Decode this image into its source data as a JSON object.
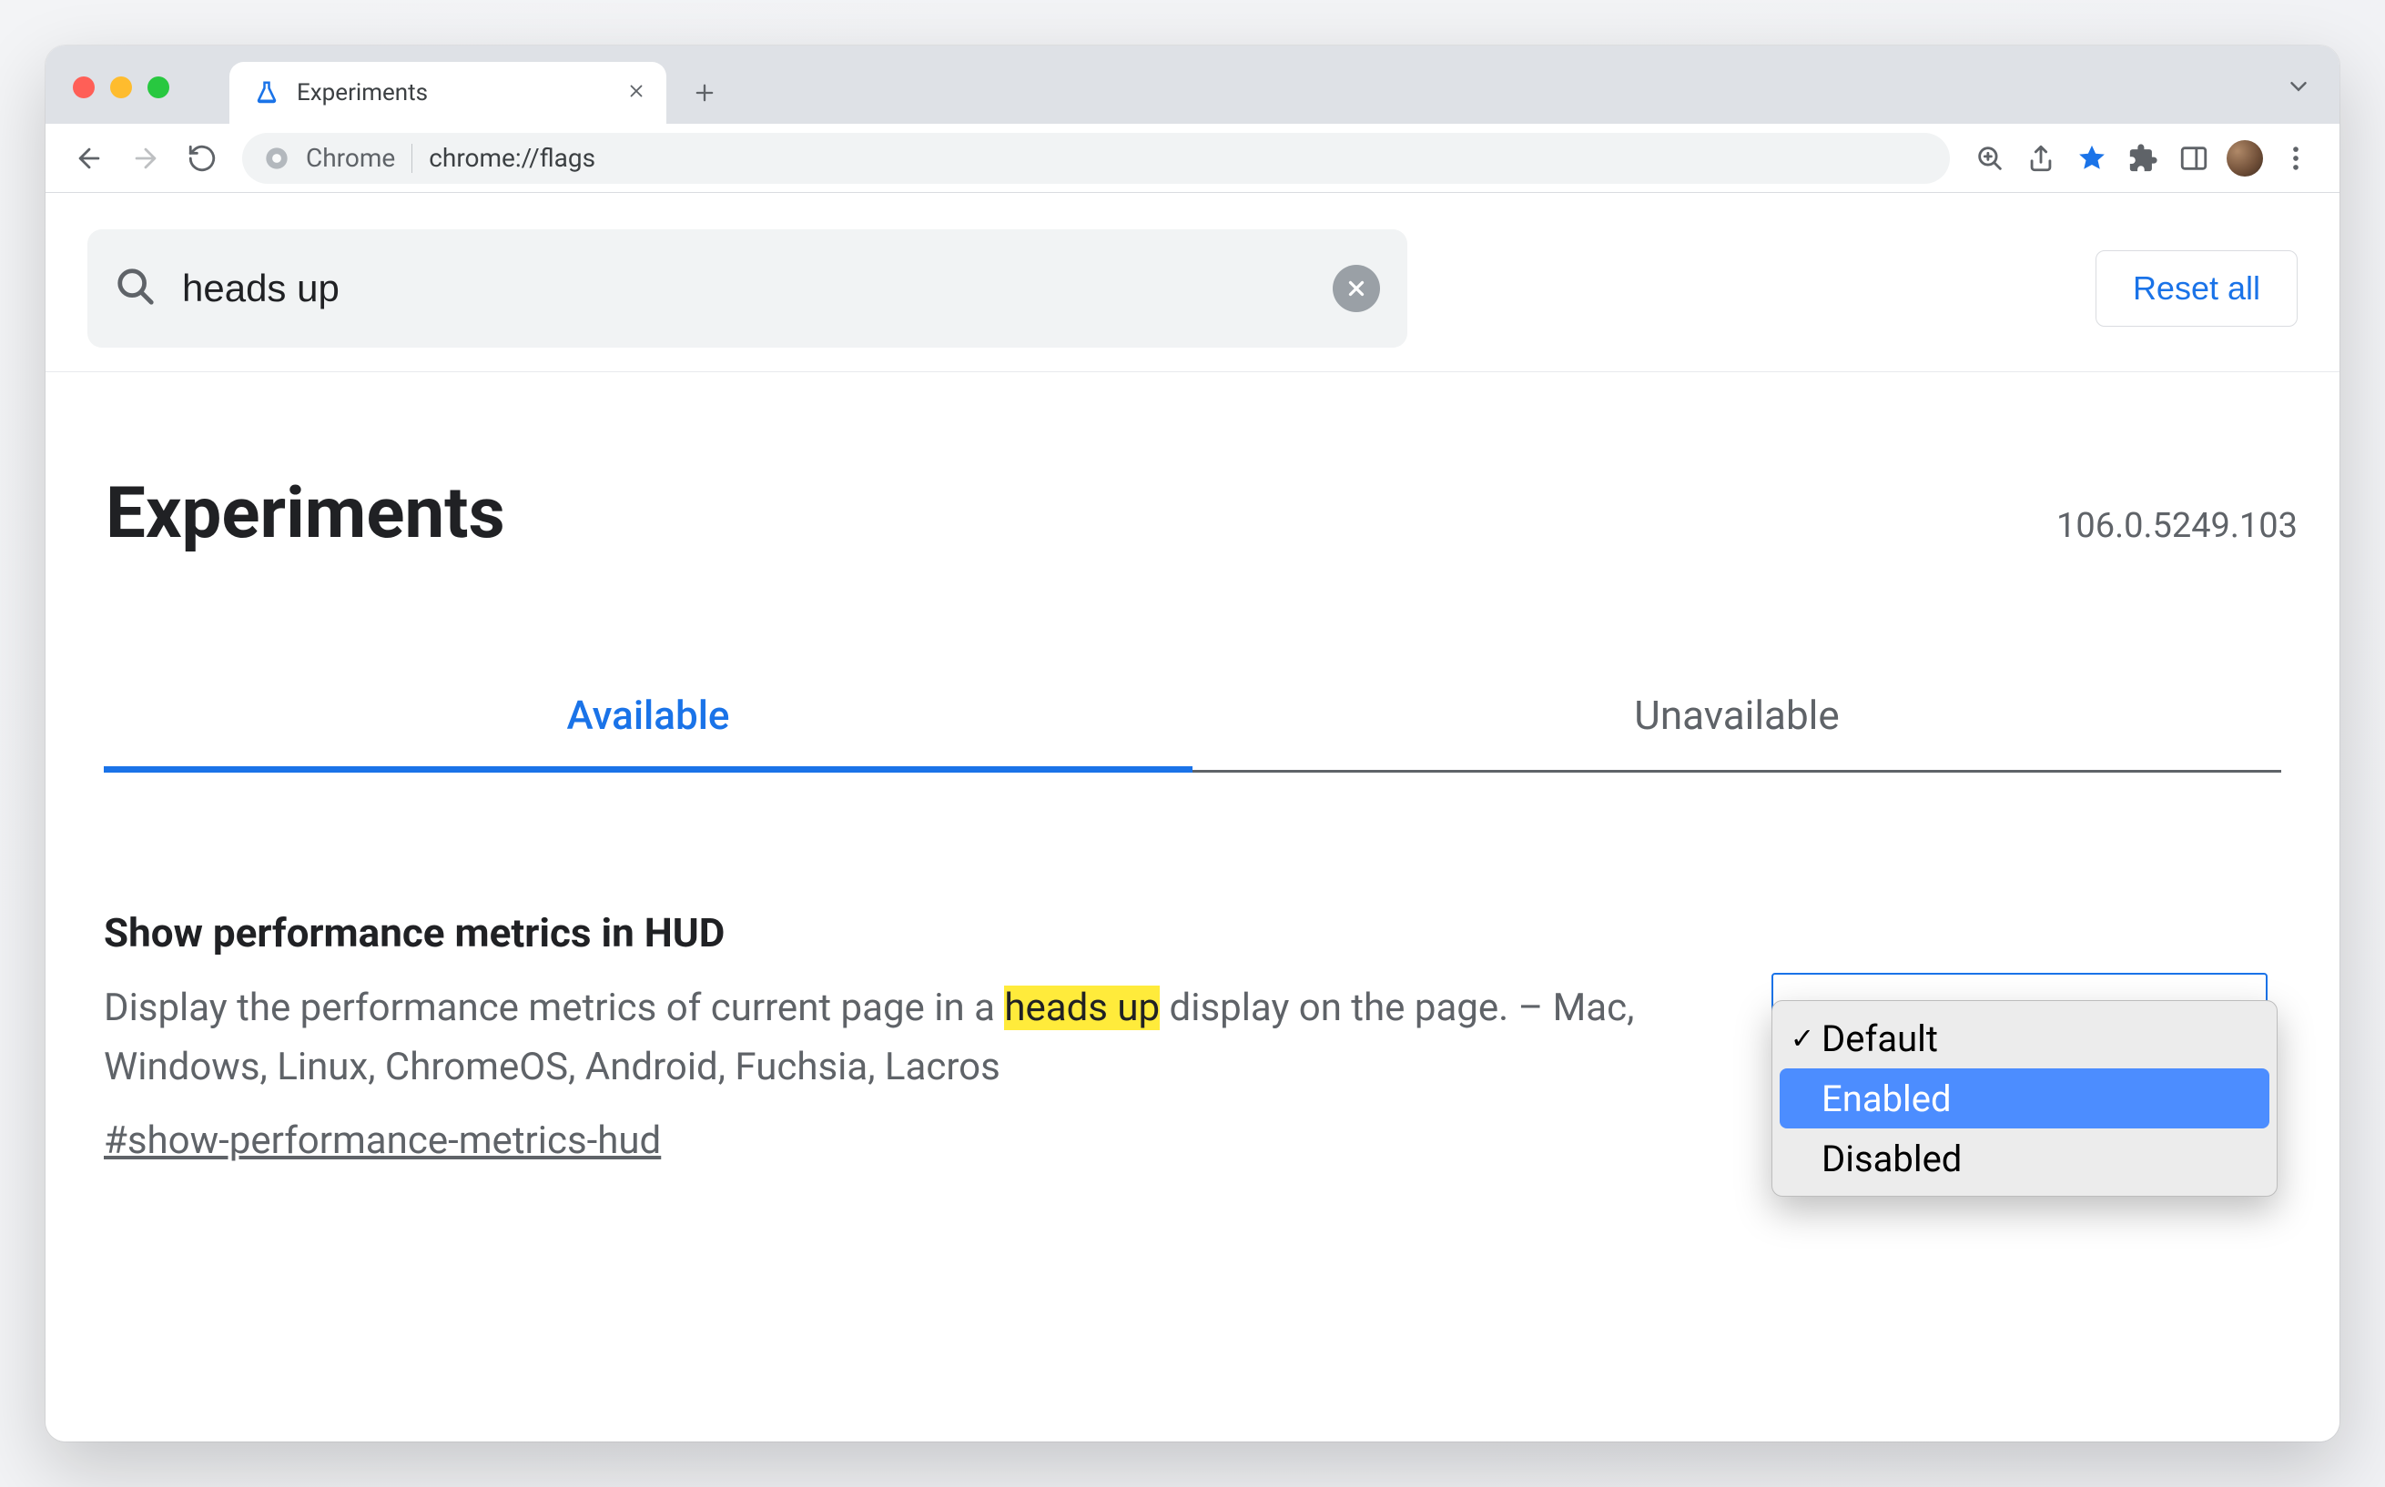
{
  "browser": {
    "tab_title": "Experiments",
    "omnibox_prefix": "Chrome",
    "omnibox_url": "chrome://flags"
  },
  "search": {
    "query": "heads up",
    "reset_label": "Reset all"
  },
  "header": {
    "title": "Experiments",
    "version": "106.0.5249.103"
  },
  "tabs": {
    "available": "Available",
    "unavailable": "Unavailable"
  },
  "flag": {
    "title": "Show performance metrics in HUD",
    "desc_before": "Display the performance metrics of current page in a ",
    "desc_highlight": "heads up",
    "desc_after": " display on the page. – Mac, Windows, Linux, ChromeOS, Android, Fuchsia, Lacros",
    "anchor": "#show-performance-metrics-hud",
    "options": {
      "default": "Default",
      "enabled": "Enabled",
      "disabled": "Disabled"
    }
  }
}
